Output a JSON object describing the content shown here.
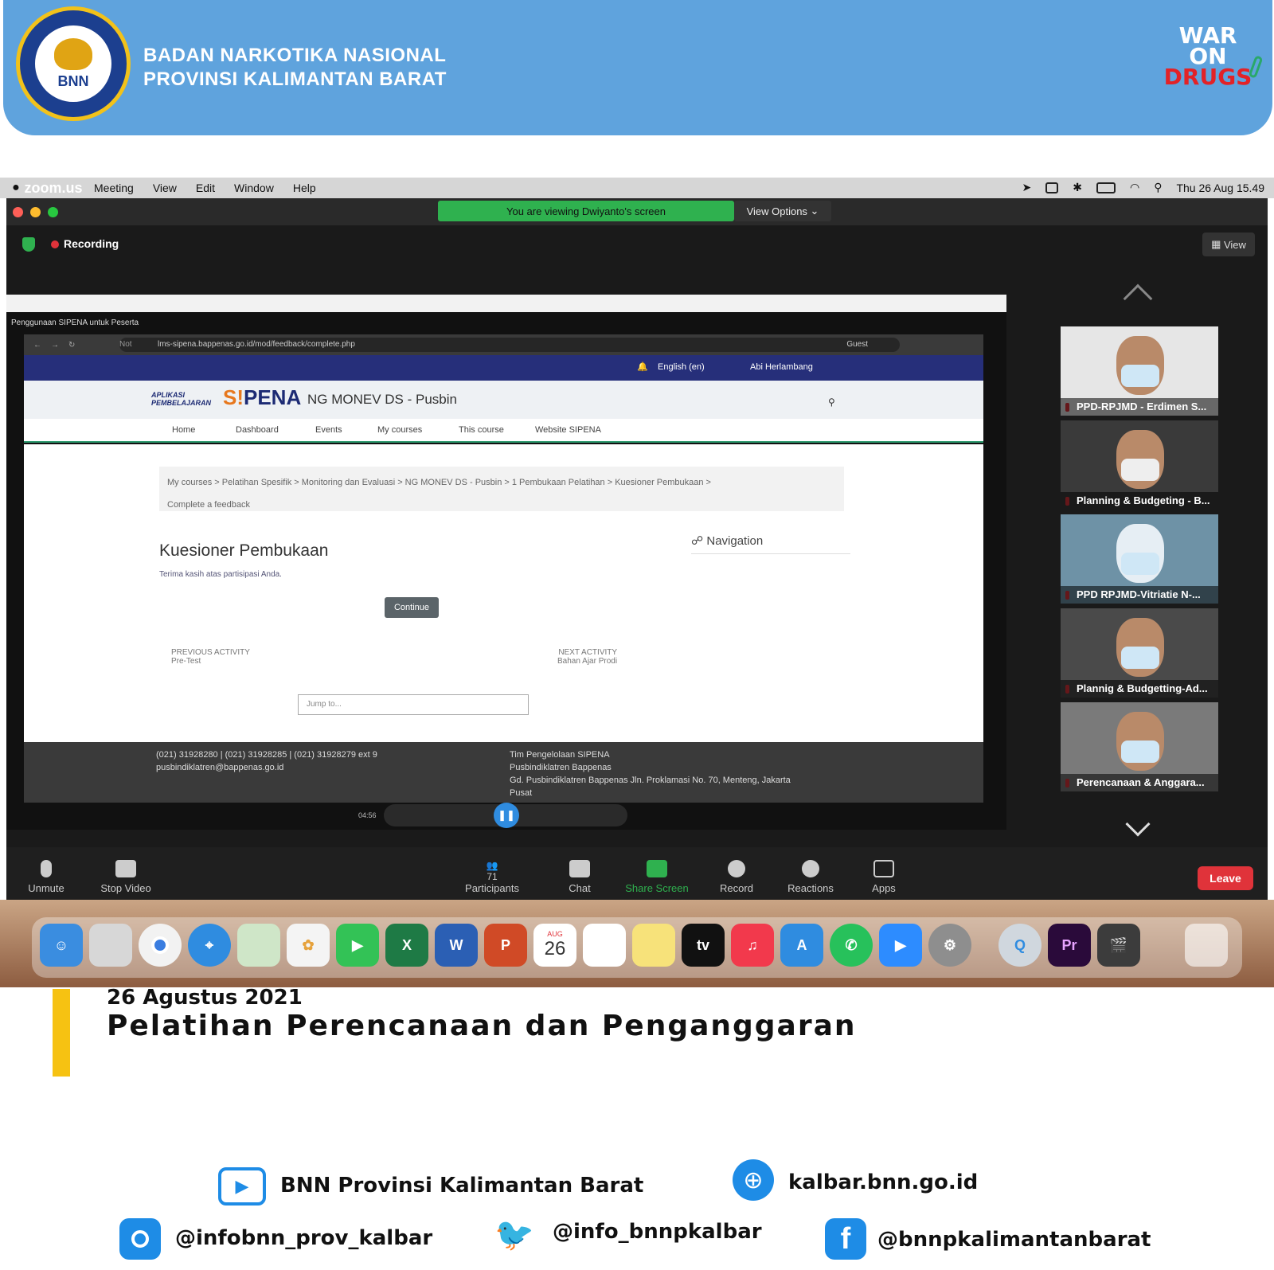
{
  "banner": {
    "org_line1": "BADAN NARKOTIKA NASIONAL",
    "org_line2": "PROVINSI KALIMANTAN BARAT",
    "logo_text": "BNN",
    "war_line1": "WAR",
    "war_line2": "ON",
    "war_line3": "DRUGS"
  },
  "menubar": {
    "app": "zoom.us",
    "items": [
      "Meeting",
      "View",
      "Edit",
      "Window",
      "Help"
    ],
    "clock": "Thu 26 Aug  15.49"
  },
  "zoom": {
    "share_notice": "You are viewing Dwiyanto's screen",
    "view_options": "View Options",
    "recording": "Recording",
    "view_button": "View",
    "participants": [
      {
        "name": "PPD-RPJMD - Erdimen S..."
      },
      {
        "name": "Planning & Budgeting - B..."
      },
      {
        "name": "PPD RPJMD-Vitriatie N-..."
      },
      {
        "name": "Plannig & Budgetting-Ad..."
      },
      {
        "name": "Perencanaan & Anggara..."
      }
    ],
    "toolbar": {
      "unmute": "Unmute",
      "stop_video": "Stop Video",
      "participants": "Participants",
      "participants_count": "71",
      "chat": "Chat",
      "share_screen": "Share Screen",
      "record": "Record",
      "reactions": "Reactions",
      "apps": "Apps",
      "leave": "Leave"
    }
  },
  "shared_screen": {
    "player_title": "Penggunaan SIPENA untuk Peserta",
    "url_secure": "Not secure",
    "url": "lms-sipena.bappenas.go.id/mod/feedback/complete.php",
    "guest": "Guest",
    "language": "English (en)",
    "user": "Abi Herlambang",
    "logo_prefix": "APLIKASI PEMBELAJARAN",
    "logo_s": "S!",
    "logo_pena": "PENA",
    "course": "NG MONEV DS - Pusbin",
    "nav": [
      "Home",
      "Dashboard",
      "Events",
      "My courses",
      "This course",
      "Website SIPENA"
    ],
    "breadcrumb": "My courses  >  Pelatihan Spesifik  >  Monitoring dan Evaluasi  >  NG MONEV DS - Pusbin  >  1 Pembukaan Pelatihan  >  Kuesioner Pembukaan  >",
    "breadcrumb2": "Complete a feedback",
    "title": "Kuesioner Pembukaan",
    "thanks": "Terima kasih atas partisipasi Anda.",
    "continue": "Continue",
    "navigation": "Navigation",
    "prev_label": "PREVIOUS ACTIVITY",
    "prev_value": "Pre-Test",
    "next_label": "NEXT ACTIVITY",
    "next_value": "Bahan Ajar Prodi",
    "jump": "Jump to...",
    "footer_phone": "(021) 31928280  |  (021) 31928285  |  (021) 31928279 ext 9",
    "footer_email": "pusbindiklatren@bappenas.go.id",
    "footer_team1": "Tim Pengelolaan SIPENA",
    "footer_team2": "Pusbindiklatren Bappenas",
    "footer_team3": "Gd. Pusbindiklatren Bappenas Jln. Proklamasi No. 70, Menteng, Jakarta",
    "footer_team4": "Pusat",
    "media_time": "04:56"
  },
  "dock": {
    "calendar_month": "AUG",
    "calendar_day": "26"
  },
  "caption": {
    "date": "26 Agustus 2021",
    "title": "Pelatihan Perencanaan dan Penganggaran"
  },
  "socials": {
    "youtube": "BNN Provinsi Kalimantan Barat",
    "website": "kalbar.bnn.go.id",
    "instagram": "@infobnn_prov_kalbar",
    "twitter": "@info_bnnpkalbar",
    "facebook": "@bnnpkalimantanbarat"
  },
  "colors": {
    "banner": "#5fa3dd",
    "accent_yellow": "#f6c212",
    "zoom_green": "#2fb14f",
    "leave_red": "#e0333a"
  }
}
